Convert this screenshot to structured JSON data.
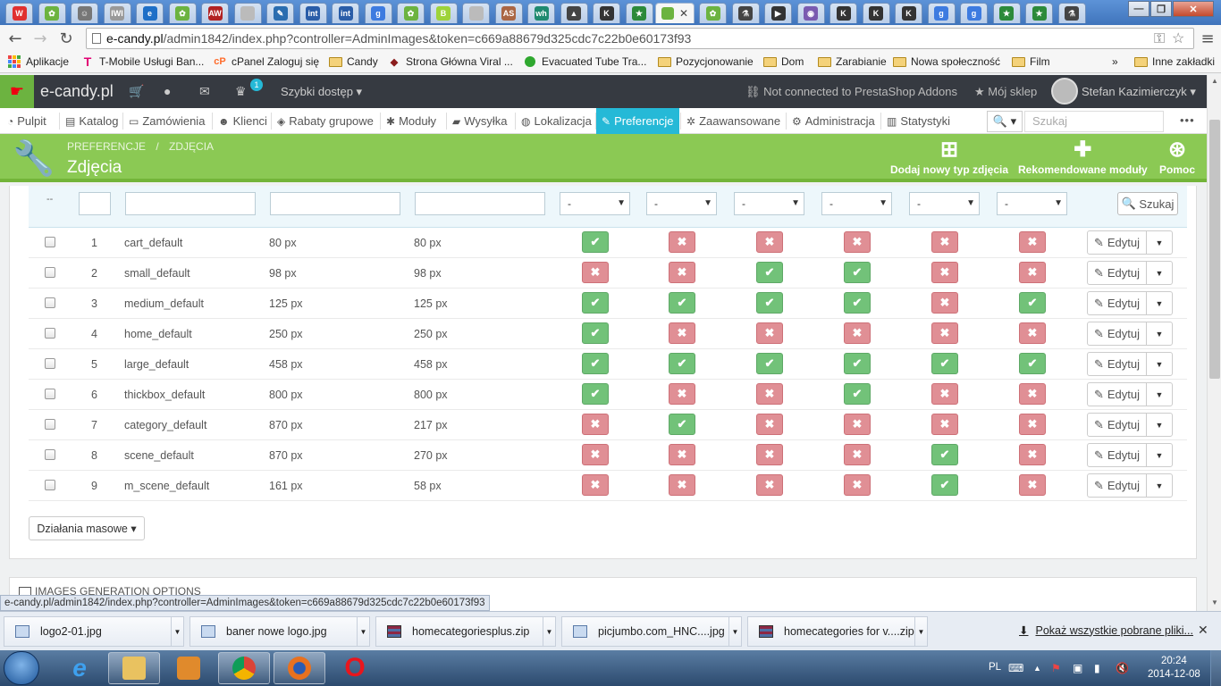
{
  "browser": {
    "tabs": [
      {
        "icon": "w-icon",
        "color": "#e03030",
        "glyph": "W"
      },
      {
        "icon": "leaf-icon",
        "color": "#6cb340",
        "glyph": "✿"
      },
      {
        "icon": "ghost-icon",
        "color": "#777777",
        "glyph": "☺"
      },
      {
        "icon": "iwi-icon",
        "color": "#999999",
        "glyph": "IWI"
      },
      {
        "icon": "ie-icon",
        "color": "#1e6fc7",
        "glyph": "e"
      },
      {
        "icon": "leaf-icon",
        "color": "#6cb340",
        "glyph": "✿"
      },
      {
        "icon": "aw-icon",
        "color": "#b22222",
        "glyph": "AW"
      },
      {
        "icon": "page-icon",
        "color": "#bbbbbb",
        "glyph": ""
      },
      {
        "icon": "pen-icon",
        "color": "#2a6db0",
        "glyph": "✎"
      },
      {
        "icon": "int-icon",
        "color": "#2a5da8",
        "glyph": "int"
      },
      {
        "icon": "int-icon",
        "color": "#2a5da8",
        "glyph": "int"
      },
      {
        "icon": "google-icon",
        "color": "#3d7be0",
        "glyph": "g"
      },
      {
        "icon": "leaf-icon",
        "color": "#6cb340",
        "glyph": "✿"
      },
      {
        "icon": "b-icon",
        "color": "#9ed33a",
        "glyph": "B"
      },
      {
        "icon": "page-icon",
        "color": "#bbbbbb",
        "glyph": ""
      },
      {
        "icon": "as-icon",
        "color": "#aa6644",
        "glyph": "AS"
      },
      {
        "icon": "wh-icon",
        "color": "#1f8a70",
        "glyph": "wh"
      },
      {
        "icon": "photo-icon",
        "color": "#444444",
        "glyph": "▲"
      },
      {
        "icon": "kt-icon",
        "color": "#333333",
        "glyph": "K"
      },
      {
        "icon": "star-icon",
        "color": "#2c8a3a",
        "glyph": "★"
      }
    ],
    "active_tab_icon": "prestashop-icon",
    "tabs_after": [
      {
        "icon": "leaf-icon",
        "color": "#6cb340",
        "glyph": "✿"
      },
      {
        "icon": "flask-icon",
        "color": "#444444",
        "glyph": "⚗"
      },
      {
        "icon": "video-icon",
        "color": "#333333",
        "glyph": "▶"
      },
      {
        "icon": "flag-icon",
        "color": "#7a5bb0",
        "glyph": "◉"
      },
      {
        "icon": "kt-icon",
        "color": "#333333",
        "glyph": "K"
      },
      {
        "icon": "kt-icon",
        "color": "#333333",
        "glyph": "K"
      },
      {
        "icon": "kt-icon",
        "color": "#333333",
        "glyph": "K"
      },
      {
        "icon": "google-icon",
        "color": "#3d7be0",
        "glyph": "g"
      },
      {
        "icon": "google-icon",
        "color": "#3d7be0",
        "glyph": "g"
      },
      {
        "icon": "star-icon",
        "color": "#2c8a3a",
        "glyph": "★"
      },
      {
        "icon": "star-icon",
        "color": "#2c8a3a",
        "glyph": "★"
      },
      {
        "icon": "flask-icon",
        "color": "#444444",
        "glyph": "⚗"
      }
    ],
    "url_domain": "e-candy.pl",
    "url_path": "/admin1842/index.php?controller=AdminImages&token=c669a88679d325cdc7c22b0e60173f93"
  },
  "bookmarks": {
    "items": [
      "Aplikacje",
      "T-Mobile Usługi Ban...",
      "cPanel Zaloguj się",
      "Candy",
      "Strona Główna Viral ...",
      "Evacuated Tube Tra...",
      "Pozycjonowanie",
      "Dom",
      "Zarabianie",
      "Nowa społeczność",
      "Film"
    ],
    "more": "»",
    "other": "Inne zakładki"
  },
  "ps_header": {
    "logo": "e-candy.pl",
    "notif_count": "1",
    "quick_access": "Szybki dostęp",
    "addons": "Not connected to PrestaShop Addons",
    "my_shop": "Mój sklep",
    "user": "Stefan Kazimierczyk"
  },
  "ps_nav": {
    "items": [
      "Pulpit",
      "Katalog",
      "Zamówienia",
      "Klienci",
      "Rabaty grupowe",
      "Moduły",
      "Wysyłka",
      "Lokalizacja",
      "Preferencje",
      "Zaawansowane",
      "Administracja",
      "Statystyki"
    ],
    "search_placeholder": "Szukaj",
    "more": "•••"
  },
  "page_head": {
    "breadcrumb": [
      "PREFERENCJE",
      "ZDJĘCIA"
    ],
    "title": "Zdjęcia",
    "actions": [
      "Dodaj nowy typ zdjęcia",
      "Rekomendowane moduły",
      "Pomoc"
    ]
  },
  "table": {
    "filter_dash": "--",
    "filter_select_value": "-",
    "search_label": "Szukaj",
    "edit_label": "Edytuj",
    "rows": [
      {
        "id": "1",
        "name": "cart_default",
        "width": "80 px",
        "height": "80 px",
        "flags": [
          true,
          false,
          false,
          false,
          false,
          false
        ]
      },
      {
        "id": "2",
        "name": "small_default",
        "width": "98 px",
        "height": "98 px",
        "flags": [
          false,
          false,
          true,
          true,
          false,
          false
        ]
      },
      {
        "id": "3",
        "name": "medium_default",
        "width": "125 px",
        "height": "125 px",
        "flags": [
          true,
          true,
          true,
          true,
          false,
          true
        ]
      },
      {
        "id": "4",
        "name": "home_default",
        "width": "250 px",
        "height": "250 px",
        "flags": [
          true,
          false,
          false,
          false,
          false,
          false
        ]
      },
      {
        "id": "5",
        "name": "large_default",
        "width": "458 px",
        "height": "458 px",
        "flags": [
          true,
          true,
          true,
          true,
          true,
          true
        ]
      },
      {
        "id": "6",
        "name": "thickbox_default",
        "width": "800 px",
        "height": "800 px",
        "flags": [
          true,
          false,
          false,
          true,
          false,
          false
        ]
      },
      {
        "id": "7",
        "name": "category_default",
        "width": "870 px",
        "height": "217 px",
        "flags": [
          false,
          true,
          false,
          false,
          false,
          false
        ]
      },
      {
        "id": "8",
        "name": "scene_default",
        "width": "870 px",
        "height": "270 px",
        "flags": [
          false,
          false,
          false,
          false,
          true,
          false
        ]
      },
      {
        "id": "9",
        "name": "m_scene_default",
        "width": "161 px",
        "height": "58 px",
        "flags": [
          false,
          false,
          false,
          false,
          true,
          false
        ]
      }
    ],
    "bulk_actions": "Działania masowe"
  },
  "section2": {
    "title": "IMAGES GENERATION OPTIONS"
  },
  "status_url": "e-candy.pl/admin1842/index.php?controller=AdminImages&token=c669a88679d325cdc7c22b0e60173f93",
  "downloads": {
    "items": [
      {
        "name": "logo2-01.jpg",
        "type": "image"
      },
      {
        "name": "baner nowe logo.jpg",
        "type": "image"
      },
      {
        "name": "homecategoriesplus.zip",
        "type": "zip"
      },
      {
        "name": "picjumbo.com_HNC....jpg",
        "type": "image"
      },
      {
        "name": "homecategories for v....zip",
        "type": "zip"
      }
    ],
    "show_all": "Pokaż wszystkie pobrane pliki..."
  },
  "taskbar": {
    "lang": "PL",
    "time": "20:24",
    "date": "2014-12-08"
  },
  "colors": {
    "ps_green": "#8bc954",
    "ps_blue": "#25b9d7",
    "yes": "#72c279",
    "no": "#e08f95"
  }
}
